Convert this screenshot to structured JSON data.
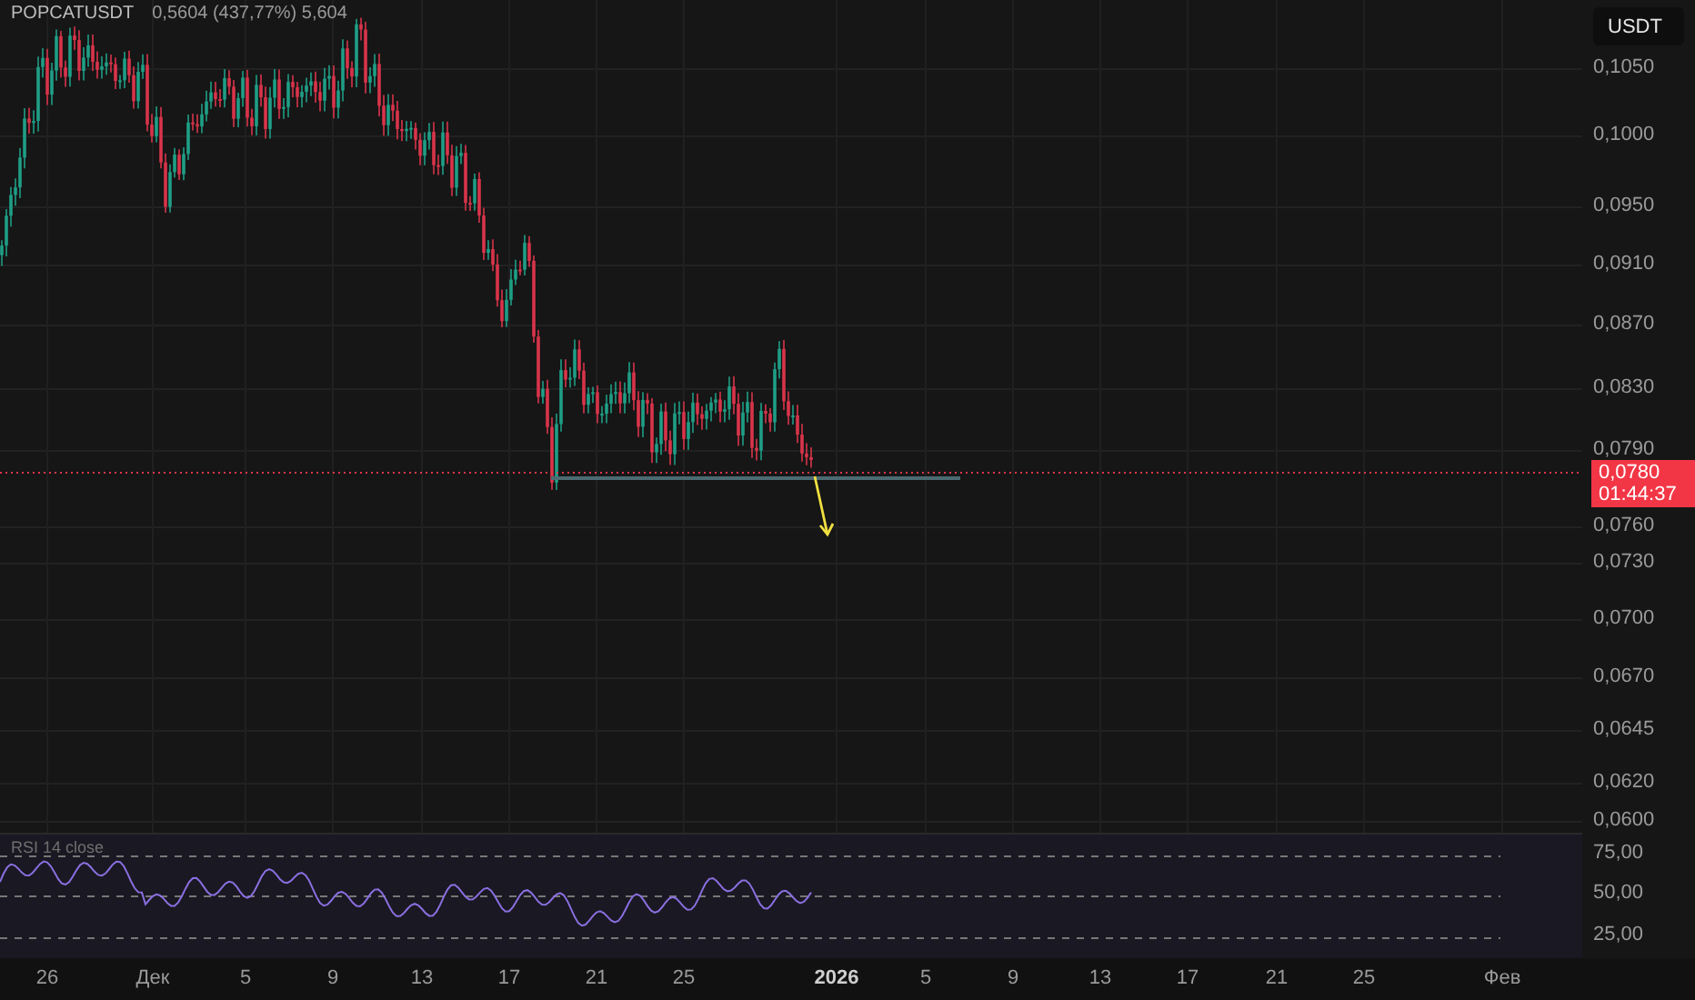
{
  "symbol": {
    "ticker": "POPCATUSDT",
    "change": "0,5604 (437,77%) 5,604"
  },
  "currency_button": "USDT",
  "price_axis": {
    "labels": [
      "0,1050",
      "0,1000",
      "0,0950",
      "0,0910",
      "0,0870",
      "0,0830",
      "0,0790",
      "0,0760",
      "0,0730",
      "0,0700",
      "0,0670",
      "0,0645",
      "0,0620",
      "0,0600"
    ],
    "last_price": "0,0780",
    "countdown": "01:44:37"
  },
  "rsi": {
    "label": "RSI 14 close",
    "labels": [
      "75,00",
      "50,00",
      "25,00"
    ]
  },
  "time_axis": [
    {
      "label": "26",
      "major": false
    },
    {
      "label": "Дек",
      "major": false
    },
    {
      "label": "5",
      "major": false
    },
    {
      "label": "9",
      "major": false
    },
    {
      "label": "13",
      "major": false
    },
    {
      "label": "17",
      "major": false
    },
    {
      "label": "21",
      "major": false
    },
    {
      "label": "25",
      "major": false
    },
    {
      "label": "2026",
      "major": true
    },
    {
      "label": "5",
      "major": false
    },
    {
      "label": "9",
      "major": false
    },
    {
      "label": "13",
      "major": false
    },
    {
      "label": "17",
      "major": false
    },
    {
      "label": "21",
      "major": false
    },
    {
      "label": "25",
      "major": false
    },
    {
      "label": "Фев",
      "major": false
    }
  ]
}
